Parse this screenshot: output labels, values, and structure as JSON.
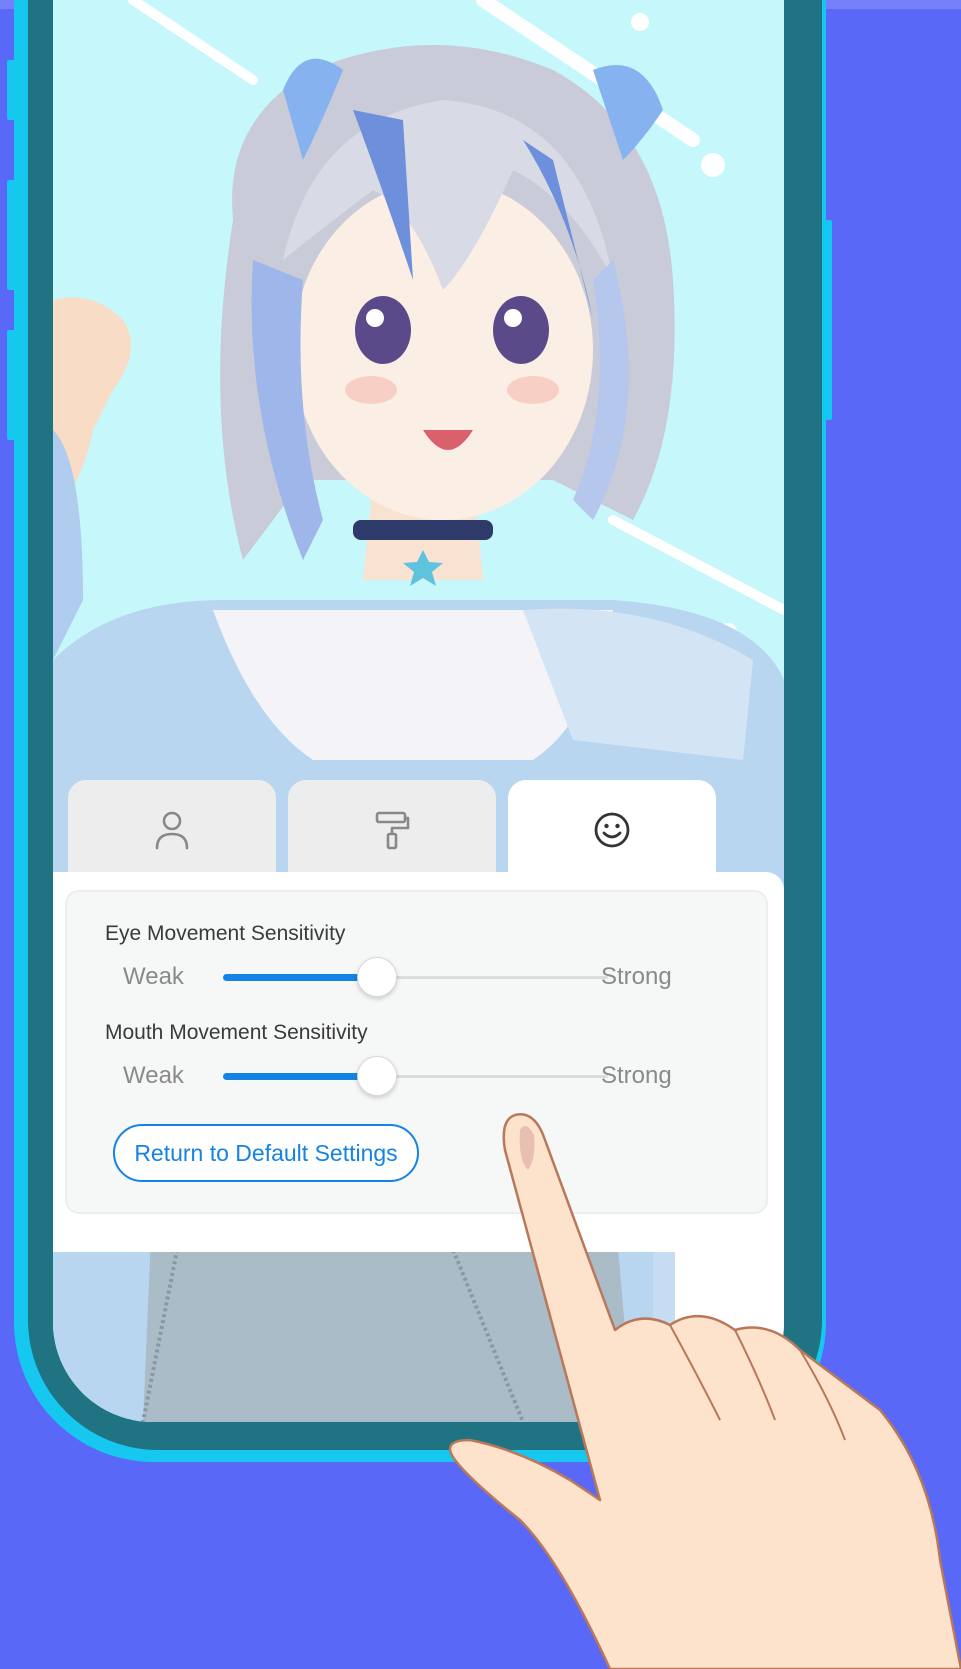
{
  "tabs": [
    {
      "icon": "person-icon",
      "active": false
    },
    {
      "icon": "paint-roller-icon",
      "active": false
    },
    {
      "icon": "smiley-icon",
      "active": true
    }
  ],
  "settings": {
    "eye": {
      "title": "Eye Movement Sensitivity",
      "min_label": "Weak",
      "max_label": "Strong",
      "value": 0.4
    },
    "mouth": {
      "title": "Mouth Movement Sensitivity",
      "min_label": "Weak",
      "max_label": "Strong",
      "value": 0.4
    },
    "reset_label": "Return to Default Settings"
  },
  "colors": {
    "background": "#5a68f8",
    "accent": "#1583e3",
    "phone_frame": "#16c8f0",
    "phone_body": "#1f7382"
  }
}
